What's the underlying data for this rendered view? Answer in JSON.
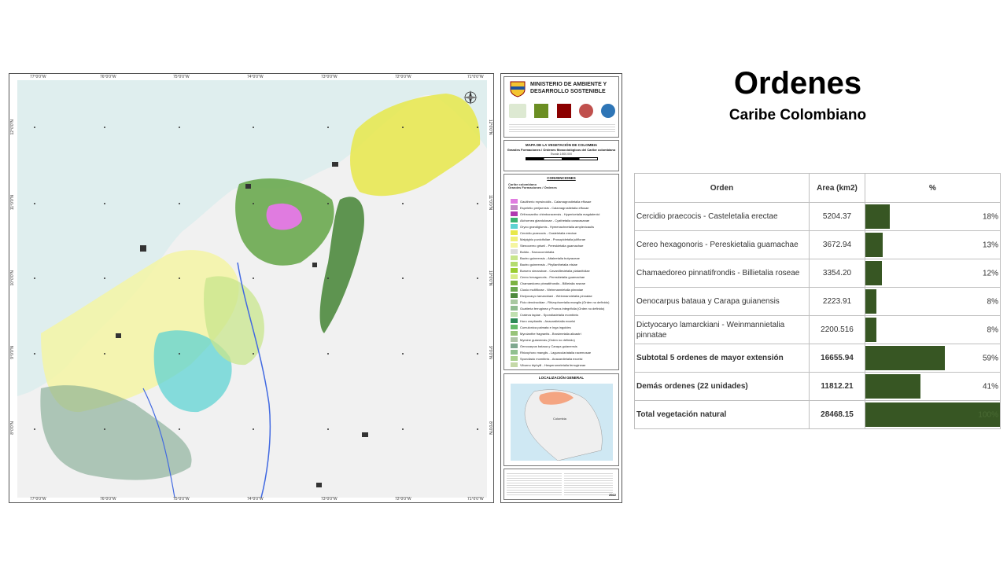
{
  "title": "Ordenes",
  "subtitle": "Caribe Colombiano",
  "colors": {
    "bar": "#375623",
    "map_sea": "#dfeeee",
    "map_land": "#f2f2f2"
  },
  "map": {
    "coords_top": [
      "77°0'0\"W",
      "76°0'0\"W",
      "75°0'0\"W",
      "74°0'0\"W",
      "73°0'0\"W",
      "72°0'0\"W",
      "71°0'0\"W"
    ],
    "coords_bottom": [
      "77°0'0\"W",
      "76°0'0\"W",
      "75°0'0\"W",
      "74°0'0\"W",
      "73°0'0\"W",
      "72°0'0\"W",
      "71°0'0\"W"
    ],
    "coords_left": [
      "12°0'0\"N",
      "11°0'0\"N",
      "10°0'0\"N",
      "9°0'0\"N",
      "8°0'0\"N"
    ],
    "coords_right": [
      "12°0'0\"N",
      "11°0'0\"N",
      "10°0'0\"N",
      "9°0'0\"N",
      "8°0'0\"N"
    ],
    "north_arrow": "N"
  },
  "legend_panel": {
    "ministry": "MINISTERIO DE AMBIENTE Y DESARROLLO SOSTENIBLE",
    "map_title": "MAPA DE LA VEGETACIÓN DE COLOMBIA",
    "map_subtitle": "Grandes Formaciones / Ordenes fitosociológicos del Caribe colombiano",
    "scale": "Escala 1:800.000",
    "conventions": "CONVENCIONES",
    "region": "Caribe colombiano",
    "group": "Grandes Formaciones / Órdenes",
    "items": [
      {
        "label": "Gaultherio myrsinoidis - Calamagrostietalia effusae",
        "color": "#e07be0"
      },
      {
        "label": "Espeletio perijaensis - Calamagrostietalia effusae",
        "color": "#c58ac7"
      },
      {
        "label": "Orthrosantho chimboracensis - Hypericetalia magdalenici",
        "color": "#b03ab0"
      },
      {
        "label": "Alchornea glandulosae - Cyathetalia caracasanae",
        "color": "#3cb371"
      },
      {
        "label": "Oryzo grandiglumis - Hymenachnetalia amplexicaulis",
        "color": "#5fd3d3"
      },
      {
        "label": "Cercidio praecocis - Casteletalia erectae",
        "color": "#e8e84a"
      },
      {
        "label": "Malpighio punicifoliae - Prosopidetalia juliflorae",
        "color": "#f0f07a"
      },
      {
        "label": "Stenocereo griseii - Pereskietalia guamachae",
        "color": "#f5f5a0"
      },
      {
        "label": "Bolido - Sarcocornietalia",
        "color": "#dcdcdc"
      },
      {
        "label": "Bactro guineensis - Attaleetalia butyraceae",
        "color": "#c8e68c"
      },
      {
        "label": "Bactro guineensis - Phyllanthetalia elsiae",
        "color": "#b4dc6e"
      },
      {
        "label": "Bursero simarubae - Cavanillesietalia platanifoliae",
        "color": "#9acd32"
      },
      {
        "label": "Cereo hexagonoris - Pereskietalia guamachae",
        "color": "#d8ec8a"
      },
      {
        "label": "Chamaedoreo pinnatifrondis - Billietalia roseae",
        "color": "#7cb342"
      },
      {
        "label": "Clusio multiflorae - Weinmannietalia pinnatae",
        "color": "#6aa84f"
      },
      {
        "label": "Dictyocaryo lamarckiani - Weinmannietalia pinnatae",
        "color": "#4e8a3e"
      },
      {
        "label": "Ficio dendrocidae - Rhizophoretalia manglis (Orden no definido)",
        "color": "#a8c8a0"
      },
      {
        "label": "Guatteria ferruginea y Prunus integrifolia (Orden no definido)",
        "color": "#8fbc8f"
      },
      {
        "label": "Crateva tapiae - Spondiadetalia mombinis",
        "color": "#c0e0b0"
      },
      {
        "label": "Huro crepitantis - Anacardietalia excelsi",
        "color": "#2e8b57"
      },
      {
        "label": "Cumulonica palmata e Inga ingoides",
        "color": "#66bb6a"
      },
      {
        "label": "Myrcianthe fragrantis - Brosimetalia alicastri",
        "color": "#98c379"
      },
      {
        "label": "Myrsine guianensis (Orden no definido)",
        "color": "#b0c4a8"
      },
      {
        "label": "Oenocarpus bataua y Carapa guianensis",
        "color": "#7fa88f"
      },
      {
        "label": "Rhizophoro manglis - Lagunculariatalia racemosae",
        "color": "#90c090"
      },
      {
        "label": "Spondiado mombinis - Anacardietalia excelsi",
        "color": "#a9d18e"
      },
      {
        "label": "Viburno triphylli - Hesperomeletalia ferrugineae",
        "color": "#c5d9a8"
      }
    ],
    "location_title": "LOCALIZACIÓN GENERAL",
    "location_label": "Colombia",
    "footer_year": "2022"
  },
  "table": {
    "headers": [
      "Orden",
      "Area (km2)",
      "%"
    ],
    "rows": [
      {
        "name": "Cercidio praecocis - Casteletalia erectae",
        "area": "5204.37",
        "pct": "18%",
        "fraction": 0.18,
        "kind": "item"
      },
      {
        "name": "Cereo hexagonoris - Pereskietalia guamachae",
        "area": "3672.94",
        "pct": "13%",
        "fraction": 0.13,
        "kind": "item"
      },
      {
        "name": "Chamaedoreo pinnatifrondis - Billietalia roseae",
        "area": "3354.20",
        "pct": "12%",
        "fraction": 0.12,
        "kind": "item"
      },
      {
        "name": "Oenocarpus bataua y Carapa guianensis",
        "area": "2223.91",
        "pct": "8%",
        "fraction": 0.08,
        "kind": "item"
      },
      {
        "name": "Dictyocaryo lamarckiani - Weinmannietalia pinnatae",
        "area": "2200.516",
        "pct": "8%",
        "fraction": 0.08,
        "kind": "item"
      },
      {
        "name": "Subtotal 5 ordenes de mayor extensión",
        "area": "16655.94",
        "pct": "59%",
        "fraction": 0.59,
        "kind": "subtotal"
      },
      {
        "name": "Demás ordenes  (22 unidades)",
        "area": "11812.21",
        "pct": "41%",
        "fraction": 0.41,
        "kind": "demas"
      },
      {
        "name": "Total vegetación natural",
        "area": "28468.15",
        "pct": "100%",
        "fraction": 1.0,
        "kind": "total"
      }
    ]
  }
}
